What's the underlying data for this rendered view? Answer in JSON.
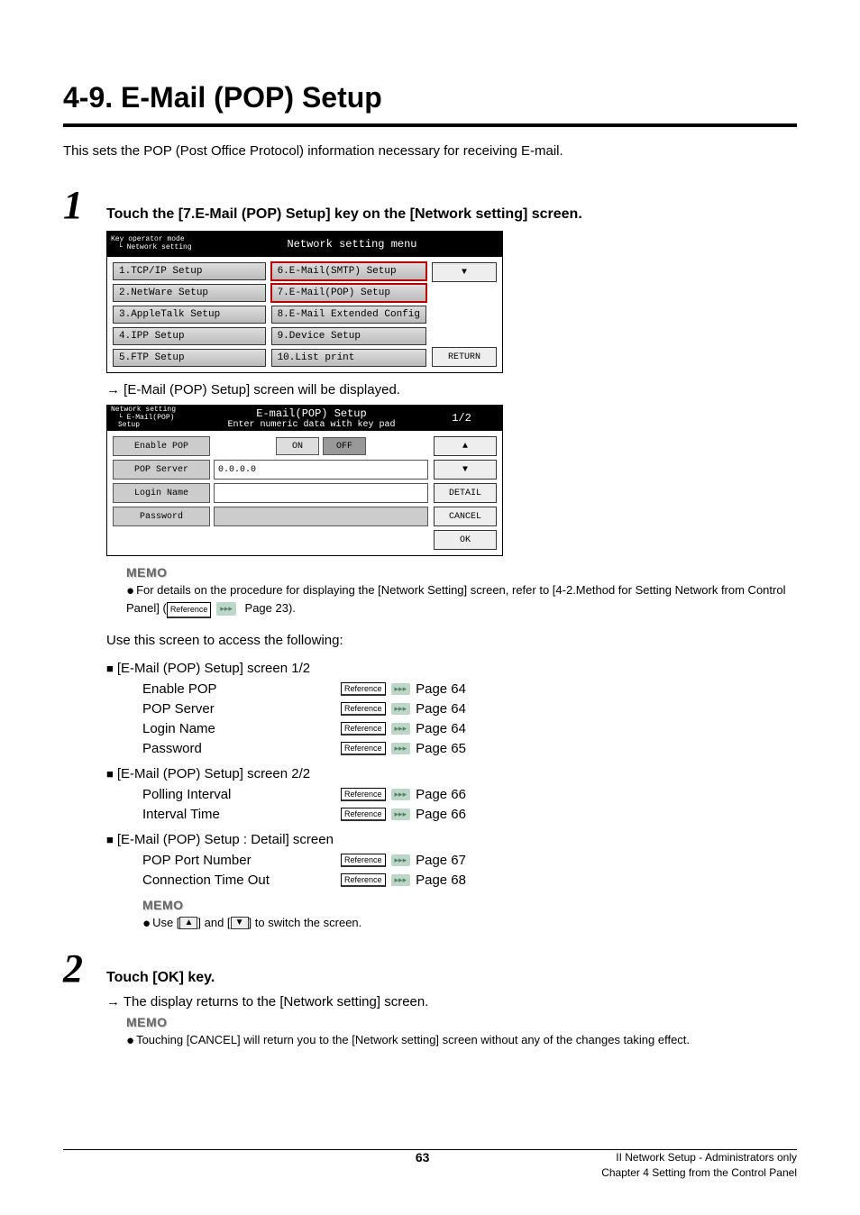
{
  "title": "4-9. E-Mail (POP) Setup",
  "intro": "This sets the POP (Post Office Protocol) information necessary for receiving E-mail.",
  "step1": {
    "num": "1",
    "text": "Touch the [7.E-Mail (POP) Setup] key on the [Network setting] screen."
  },
  "network_panel": {
    "breadcrumb1": "Key operator mode",
    "breadcrumb2": "Network setting",
    "title": "Network setting menu",
    "left": [
      "1.TCP/IP Setup",
      "2.NetWare Setup",
      "3.AppleTalk Setup",
      "4.IPP Setup",
      "5.FTP Setup"
    ],
    "right": [
      "6.E-Mail(SMTP) Setup",
      "7.E-Mail(POP) Setup",
      "8.E-Mail Extended Config",
      "9.Device Setup",
      "10.List print"
    ],
    "return": "RETURN"
  },
  "step1_result": "→ [E-Mail (POP) Setup] screen will be displayed.",
  "pop_panel": {
    "breadcrumb1": "Network setting",
    "breadcrumb2": "E-Mail(POP) Setup",
    "title": "E-mail(POP) Setup",
    "subtitle": "Enter numeric data with key pad",
    "page": "1/2",
    "rows": {
      "enable_label": "Enable POP",
      "on": "ON",
      "off": "OFF",
      "server_label": "POP Server",
      "server_value": "0.0.0.0",
      "login_label": "Login Name",
      "login_value": "",
      "password_label": "Password",
      "password_value": ""
    },
    "side": {
      "detail": "DETAIL",
      "cancel": "CANCEL",
      "ok": "OK"
    }
  },
  "memo1": {
    "title": "MEMO",
    "text_a": "For details on the procedure for displaying the [Network Setting] screen, refer to [4-2.Method for Setting Network from Control Panel] (",
    "ref": "Reference",
    "text_b": " Page 23)."
  },
  "use_text": "Use this screen to access the following:",
  "tables": [
    {
      "head": "[E-Mail (POP) Setup] screen 1/2",
      "rows": [
        {
          "label": "Enable POP",
          "page": "Page 64"
        },
        {
          "label": "POP Server",
          "page": "Page 64"
        },
        {
          "label": "Login Name",
          "page": "Page 64"
        },
        {
          "label": "Password",
          "page": "Page 65"
        }
      ]
    },
    {
      "head": "[E-Mail (POP) Setup] screen 2/2",
      "rows": [
        {
          "label": "Polling Interval",
          "page": "Page 66"
        },
        {
          "label": "Interval Time",
          "page": "Page 66"
        }
      ]
    },
    {
      "head": "[E-Mail (POP) Setup : Detail] screen",
      "rows": [
        {
          "label": "POP Port Number",
          "page": "Page 67"
        },
        {
          "label": "Connection Time Out",
          "page": "Page 68"
        }
      ]
    }
  ],
  "reference_label": "Reference",
  "pointer_glyph": "▸▸▸",
  "memo2": {
    "title": "MEMO",
    "prefix": "Use [",
    "mid": "] and [",
    "suffix": "] to switch the screen."
  },
  "step2": {
    "num": "2",
    "text": "Touch [OK] key.",
    "result": "→ The display returns to the [Network setting] screen."
  },
  "memo3": {
    "title": "MEMO",
    "text": "Touching [CANCEL] will return you to the [Network setting] screen without any of the changes taking effect."
  },
  "footer": {
    "page": "63",
    "right1": "II Network Setup - Administrators only",
    "right2": "Chapter 4 Setting from the Control Panel"
  }
}
